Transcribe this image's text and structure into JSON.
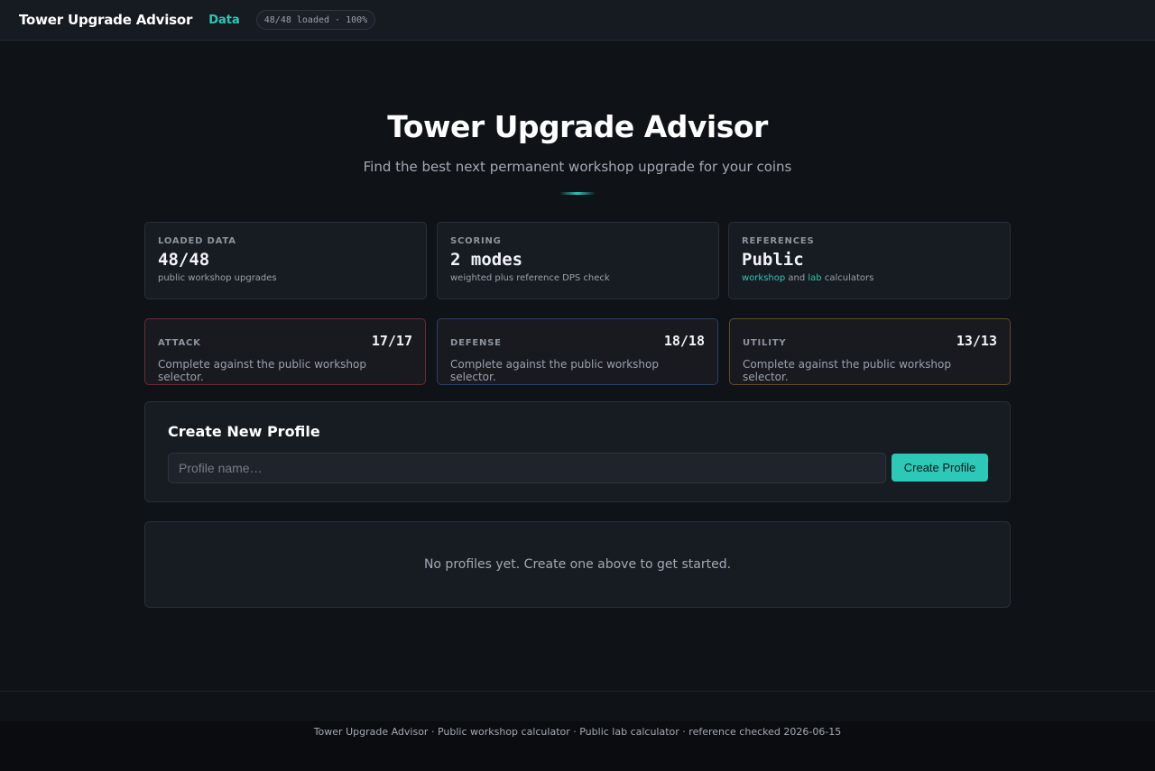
{
  "header": {
    "brand": "Tower Upgrade Advisor",
    "nav_link": "Data",
    "load_status": "48/48 loaded · 100%"
  },
  "hero": {
    "title": "Tower Upgrade Advisor",
    "subtitle": "Find the best next permanent workshop upgrade for your coins"
  },
  "stats": [
    {
      "label": "LOADED DATA",
      "value": "48/48",
      "desc": "public workshop upgrades"
    },
    {
      "label": "SCORING",
      "value": "2 modes",
      "desc": "weighted plus reference DPS check"
    },
    {
      "label": "REFERENCES",
      "value": "Public",
      "desc_link1": "workshop",
      "desc_mid": " and ",
      "desc_link2": "lab",
      "desc_end": " calculators"
    }
  ],
  "categories": [
    {
      "label": "ATTACK",
      "count": "17/17",
      "desc": "Complete against the public workshop selector.",
      "accent": "#6e2a30"
    },
    {
      "label": "DEFENSE",
      "count": "18/18",
      "desc": "Complete against the public workshop selector.",
      "accent": "#26406b"
    },
    {
      "label": "UTILITY",
      "count": "13/13",
      "desc": "Complete against the public workshop selector.",
      "accent": "#6a4a24"
    }
  ],
  "create_profile": {
    "title": "Create New Profile",
    "input_placeholder": "Profile name…",
    "input_value": "",
    "button_label": "Create Profile"
  },
  "profiles": {
    "empty_message": "No profiles yet. Create one above to get started."
  },
  "footer": {
    "text": "Tower Upgrade Advisor · Public workshop calculator · Public lab calculator · reference checked 2026-06-15"
  },
  "colors": {
    "accent": "#2cc8b8",
    "background": "#0f1217",
    "card": "#171b22"
  }
}
